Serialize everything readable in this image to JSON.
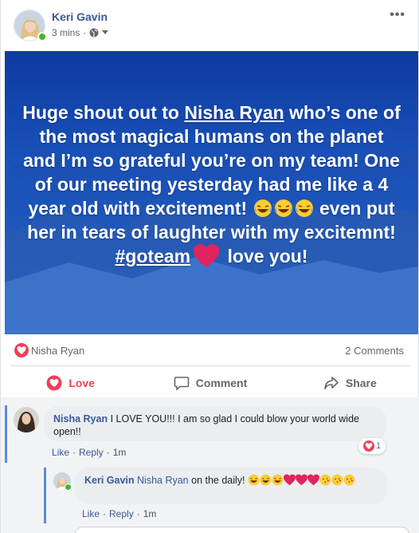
{
  "post": {
    "author": "Keri Gavin",
    "time": "3 mins",
    "separator": "·",
    "more_menu": "•••",
    "privacy_icon": "globe-icon",
    "banner": {
      "text_1": "Huge shout out to ",
      "mention": "Nisha Ryan",
      "text_2": " who’s one of the most magical humans on the planet and I’m so grateful you’re on my team! One of our meeting yesterday had me like a 4 year old with excitement! ",
      "text_3": " even put her in tears of laughter with my excitemnt! ",
      "hashtag": "#goteam",
      "text_4": " love you!",
      "colors": {
        "top": "#0d3aa0",
        "bottom": "#3a7fd4",
        "mountain": "#2c5bb0"
      }
    },
    "reactions": {
      "icon": "love-reaction-icon",
      "name": "Nisha Ryan",
      "comments_count": "2 Comments"
    },
    "actions": {
      "love": "Love",
      "comment": "Comment",
      "share": "Share"
    },
    "colors": {
      "link": "#385898",
      "love": "#f33e58",
      "muted": "#616770"
    }
  },
  "comments": [
    {
      "author": "Nisha Ryan",
      "text": "I LOVE YOU!!! I am so glad I could blow your world wide open!!",
      "like": "Like",
      "reply": "Reply",
      "time": "1m",
      "reaction_count": "1"
    },
    {
      "author": "Keri Gavin",
      "mention": "Nisha Ryan",
      "text": " on the daily! ",
      "like": "Like",
      "reply": "Reply",
      "time": "1m"
    }
  ]
}
